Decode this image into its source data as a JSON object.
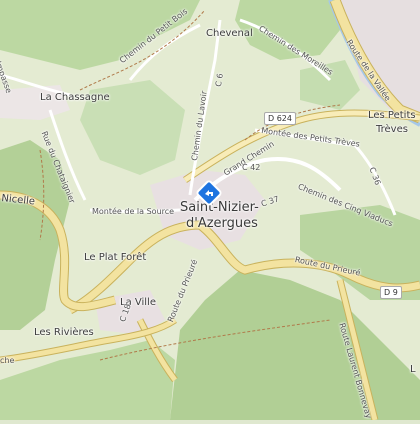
{
  "places": {
    "chevenal": "Chevenal",
    "la_chassagne": "La Chassagne",
    "les_petits_treves_1": "Les Petits",
    "les_petits_treves_2": "Trèves",
    "le_plat_foret": "Le Plat Forêt",
    "la_ville": "La Ville",
    "les_rivieres": "Les Rivières",
    "town_line1": "Saint-Nizier-",
    "town_line2": "d'Azergues"
  },
  "streets": {
    "chemin_petit_bois": "Chemin du Petit Bois",
    "chemin_moreilles": "Chemin des Moreilles",
    "route_vallee": "Route de la Vallée",
    "chemin_lavoir": "Chemin du Lavoir",
    "c6": "C 6",
    "montee_petits_treves": "Montée des Petits Trèves",
    "rue_chataignier": "Rue du Chataignier",
    "grand_chemin": "Grand Chemin",
    "c42": "C 42",
    "c36": "C 36",
    "chemin_cinq_viaducs": "Chemin des Cinq Viaducs",
    "nicelle": "Nicelle",
    "montee_source": "Montée de la Source",
    "c37": "C 37",
    "route_prieure_1": "Route du Prieuré",
    "route_prieure_2": "Route du Prieuré",
    "c18": "C 18",
    "route_laurent": "Route Laurent Bonnevay",
    "impasse": "Impasse",
    "che": "che",
    "l_partial": "L"
  },
  "road_shields": {
    "d624": "D 624",
    "d9": "D 9"
  },
  "marker": {
    "icon": "location-pin-icon",
    "color": "#1e74e0"
  },
  "colors": {
    "forest": "#b9d5a0",
    "forest_dark": "#a9c98f",
    "meadow": "#e6ecd3",
    "urban": "#e6dfe0",
    "road_major": "#f3e3a0",
    "road_major_casing": "#c9b25c",
    "road_minor": "#ffffff",
    "path": "#b07a4a"
  }
}
